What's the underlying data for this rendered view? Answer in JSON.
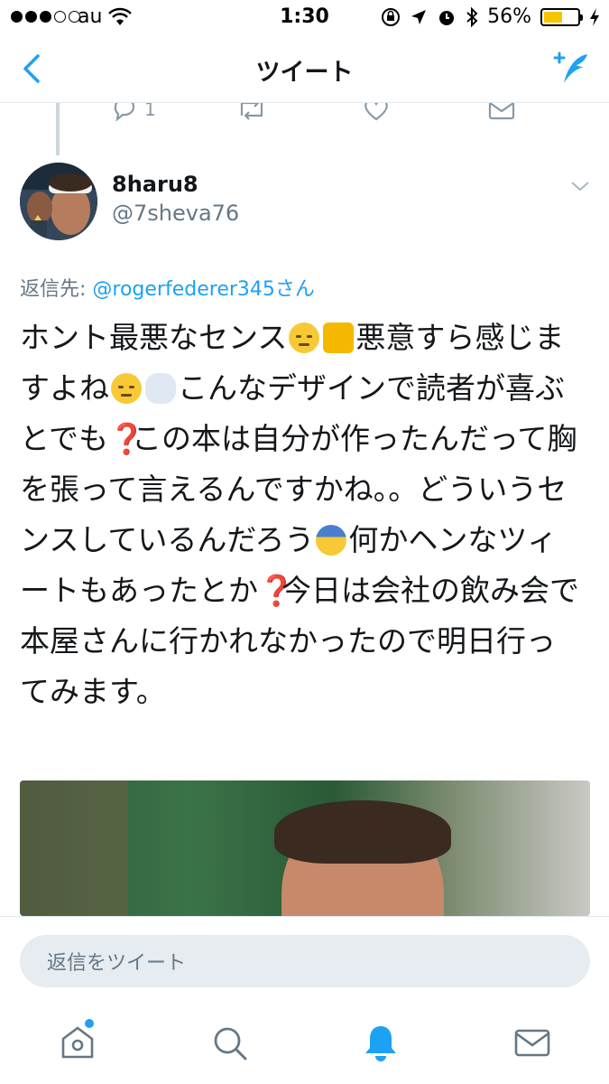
{
  "status_bar": {
    "carrier": "au",
    "time": "1:30",
    "battery_percent": "56%",
    "battery_level": 0.56,
    "signal_bars_filled": 3,
    "signal_bars_total": 5
  },
  "nav": {
    "title": "ツイート"
  },
  "previous_tweet": {
    "reply_count": "1"
  },
  "tweet": {
    "display_name": "8haru8",
    "handle": "@7sheva76",
    "reply_to_label": "返信先: ",
    "reply_to_mention": "@rogerfederer345さん",
    "text_segments": {
      "s1": "ホント最悪なセンス",
      "s2": "悪意すら感じますよね",
      "s3": "こんなデザインで読者が喜ぶとでも",
      "s4": "この本は自分が作ったんだって胸を張って言えるんですかね。。どういうセンスしているんだろう",
      "s5": "何かヘンなツィートもあったとか",
      "s6": "今日は会社の飲み会で本屋さんに行かれなかったので明日行ってみます。"
    },
    "question_mark": "❓"
  },
  "reply_bar": {
    "placeholder": "返信をツイート"
  },
  "colors": {
    "accent": "#1da1f2",
    "secondary_text": "#657786",
    "divider": "#e1e8ed"
  },
  "icons": {
    "back": "chevron-left-icon",
    "compose": "compose-tweet-icon",
    "reply": "reply-icon",
    "retweet": "retweet-icon",
    "like": "heart-icon",
    "dm": "mail-icon",
    "caret": "chevron-down-icon",
    "home": "home-icon",
    "search": "search-icon",
    "notifications": "bell-icon",
    "messages": "mail-icon"
  }
}
